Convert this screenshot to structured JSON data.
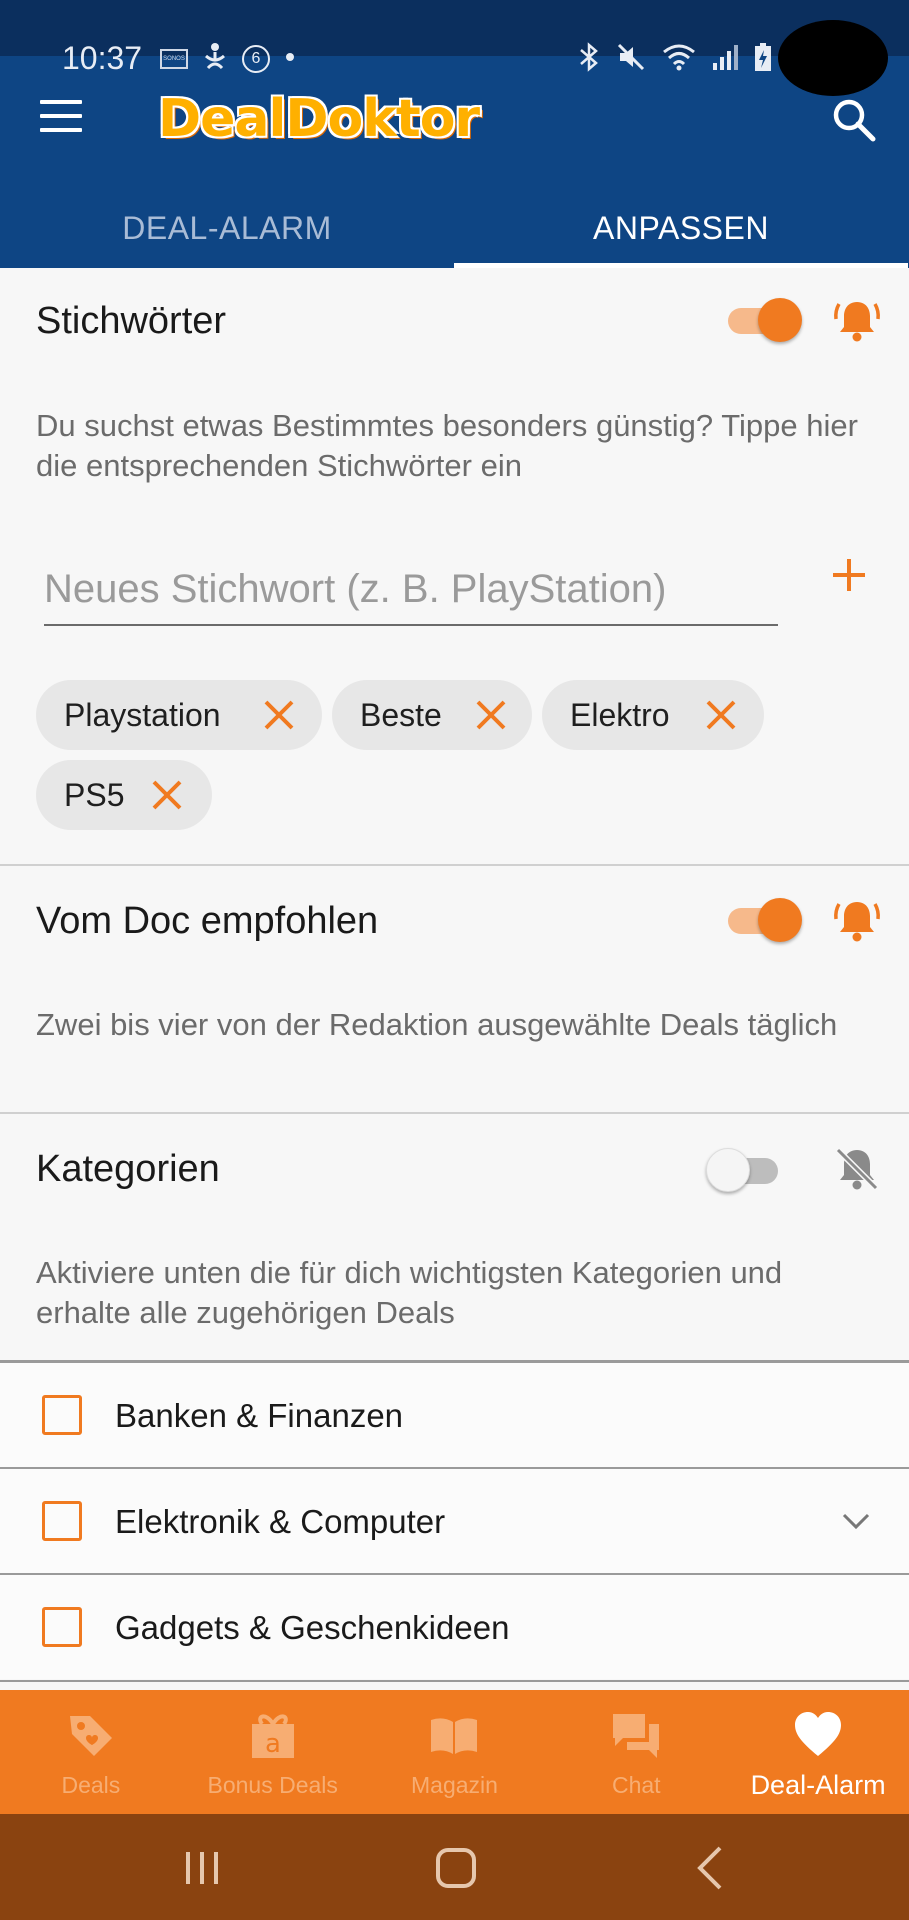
{
  "status_bar": {
    "time": "10:37",
    "left_icons": [
      "sonos-icon",
      "yoga-icon",
      "notification-count-icon",
      "dot-icon"
    ],
    "notification_count": "6",
    "sonos_text": "SONOS",
    "right_icons": [
      "bluetooth-icon",
      "mute-icon",
      "wifi-icon",
      "signal-icon",
      "battery-icon"
    ]
  },
  "header": {
    "logo_part1": "Deal",
    "logo_part2": "Doktor",
    "menu_icon": "hamburger-menu-icon",
    "search_icon": "search-icon"
  },
  "tabs": [
    {
      "label": "DEAL-ALARM",
      "active": false
    },
    {
      "label": "ANPASSEN",
      "active": true
    }
  ],
  "keywords_section": {
    "title": "Stichwörter",
    "toggle_on": true,
    "bell": "bell-ringing-icon",
    "description": "Du suchst etwas Bestimmtes besonders günstig? Tippe hier die entsprechenden Stichwörter ein",
    "input_placeholder": "Neues Stichwort (z. B. PlayStation)",
    "input_value": "",
    "add_icon": "plus-icon",
    "chips": [
      "Playstation",
      "Beste",
      "Elektro",
      "PS5"
    ]
  },
  "doc_section": {
    "title": "Vom Doc empfohlen",
    "toggle_on": true,
    "bell": "bell-ringing-icon",
    "description": "Zwei bis vier von der Redaktion ausgewählte Deals täglich"
  },
  "categories_section": {
    "title": "Kategorien",
    "toggle_on": false,
    "bell": "bell-off-icon",
    "description": "Aktiviere unten die für dich wichtigsten Kategorien und erhalte alle zugehörigen Deals",
    "items": [
      {
        "label": "Banken & Finanzen",
        "checked": false,
        "expandable": false
      },
      {
        "label": "Elektronik & Computer",
        "checked": false,
        "expandable": true
      },
      {
        "label": "Gadgets & Geschenkideen",
        "checked": false,
        "expandable": false
      }
    ]
  },
  "bottom_nav": [
    {
      "label": "Deals",
      "icon": "tag-icon",
      "active": false
    },
    {
      "label": "Bonus Deals",
      "icon": "gift-icon",
      "active": false
    },
    {
      "label": "Magazin",
      "icon": "book-icon",
      "active": false
    },
    {
      "label": "Chat",
      "icon": "chat-icon",
      "active": false
    },
    {
      "label": "Deal-Alarm",
      "icon": "heart-icon",
      "active": true
    }
  ],
  "system_nav": [
    "recents-icon",
    "home-icon",
    "back-icon"
  ],
  "colors": {
    "accent": "#f07a20",
    "header": "#0e4584",
    "status_bar": "#0b2f5e",
    "system_nav": "#8a4310"
  }
}
